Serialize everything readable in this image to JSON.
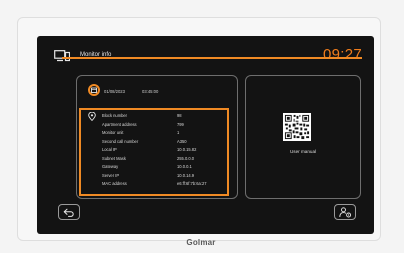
{
  "header": {
    "title": "Monitor info",
    "clock": "09:27",
    "icon": "monitor-info-icon"
  },
  "info_panel": {
    "date": "01/08/2023",
    "time": "03:45:00",
    "rows": [
      {
        "label": "Block number",
        "value": "98"
      },
      {
        "label": "Apartment address",
        "value": "799"
      },
      {
        "label": "Monitor unit",
        "value": "1"
      },
      {
        "label": "Second call number",
        "value": "A350"
      },
      {
        "label": "Local IP",
        "value": "10.0.15.82"
      },
      {
        "label": "Subnet Mask",
        "value": "255.0.0.0"
      },
      {
        "label": "Gateway",
        "value": "10.0.0.1"
      },
      {
        "label": "Server IP",
        "value": "10.0.14.9"
      },
      {
        "label": "MAC address",
        "value": "e6:ff:6f:7b:6a:27"
      }
    ]
  },
  "manual_panel": {
    "label": "User manual",
    "icon": "qr-code-icon"
  },
  "buttons": {
    "back_icon": "return-icon",
    "user_icon": "user-settings-icon"
  },
  "brand": "Golmar",
  "colors": {
    "accent": "#f07d1c",
    "screen_bg": "#131313",
    "panel_border": "#6e6e6e"
  }
}
